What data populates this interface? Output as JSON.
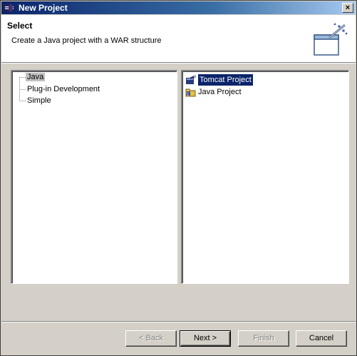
{
  "window": {
    "title": "New Project",
    "close_glyph": "×"
  },
  "banner": {
    "title": "Select",
    "description": "Create a Java project with a WAR structure",
    "icon": "new-project-wizard-icon"
  },
  "tree": {
    "items": [
      {
        "label": "Java",
        "selected": true
      },
      {
        "label": "Plug-in Development",
        "selected": false
      },
      {
        "label": "Simple",
        "selected": false
      }
    ]
  },
  "list": {
    "items": [
      {
        "label": "Tomcat Project",
        "icon": "tomcat-project-icon",
        "selected": true
      },
      {
        "label": "Java Project",
        "icon": "java-project-icon",
        "selected": false
      }
    ]
  },
  "buttons": {
    "back": "< Back",
    "next": "Next >",
    "finish": "Finish",
    "cancel": "Cancel"
  },
  "colors": {
    "title_bar": "#0a246a",
    "selection": "#0a246a",
    "dialog_bg": "#d4d0c8"
  }
}
